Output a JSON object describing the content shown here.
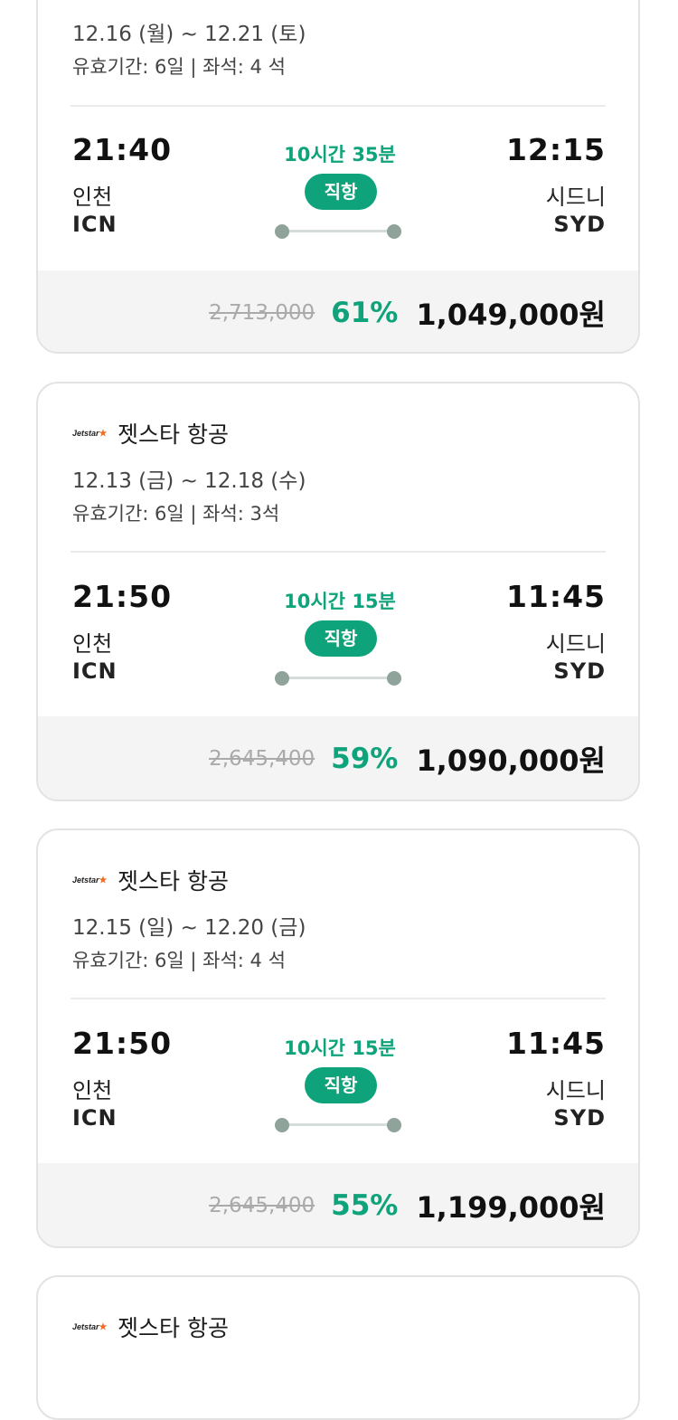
{
  "cards": [
    {
      "airline": "",
      "dates": "12.16 (월) ~ 12.21 (토)",
      "validity": "유효기간: 6일 | 좌석: 4 석",
      "dep_time": "21:40",
      "dep_city": "인천",
      "dep_code": "ICN",
      "arr_time": "12:15",
      "arr_city": "시드니",
      "arr_code": "SYD",
      "duration": "10시간 35분",
      "badge": "직항",
      "orig_price": "2,713,000",
      "discount": "61%",
      "price": "1,049,000원"
    },
    {
      "logo": "Jetstar",
      "airline": "젯스타 항공",
      "dates": "12.13 (금) ~ 12.18 (수)",
      "validity": "유효기간: 6일 | 좌석: 3석",
      "dep_time": "21:50",
      "dep_city": "인천",
      "dep_code": "ICN",
      "arr_time": "11:45",
      "arr_city": "시드니",
      "arr_code": "SYD",
      "duration": "10시간 15분",
      "badge": "직항",
      "orig_price": "2,645,400",
      "discount": "59%",
      "price": "1,090,000원"
    },
    {
      "logo": "Jetstar",
      "airline": "젯스타 항공",
      "dates": "12.15 (일) ~ 12.20 (금)",
      "validity": "유효기간: 6일 | 좌석: 4 석",
      "dep_time": "21:50",
      "dep_city": "인천",
      "dep_code": "ICN",
      "arr_time": "11:45",
      "arr_city": "시드니",
      "arr_code": "SYD",
      "duration": "10시간 15분",
      "badge": "직항",
      "orig_price": "2,645,400",
      "discount": "55%",
      "price": "1,199,000원"
    },
    {
      "logo": "Jetstar",
      "airline": "젯스타 항공"
    }
  ],
  "colors": {
    "accent": "#0ea37a",
    "price_bg": "#f4f4f4",
    "logo_star": "#f26a21"
  }
}
